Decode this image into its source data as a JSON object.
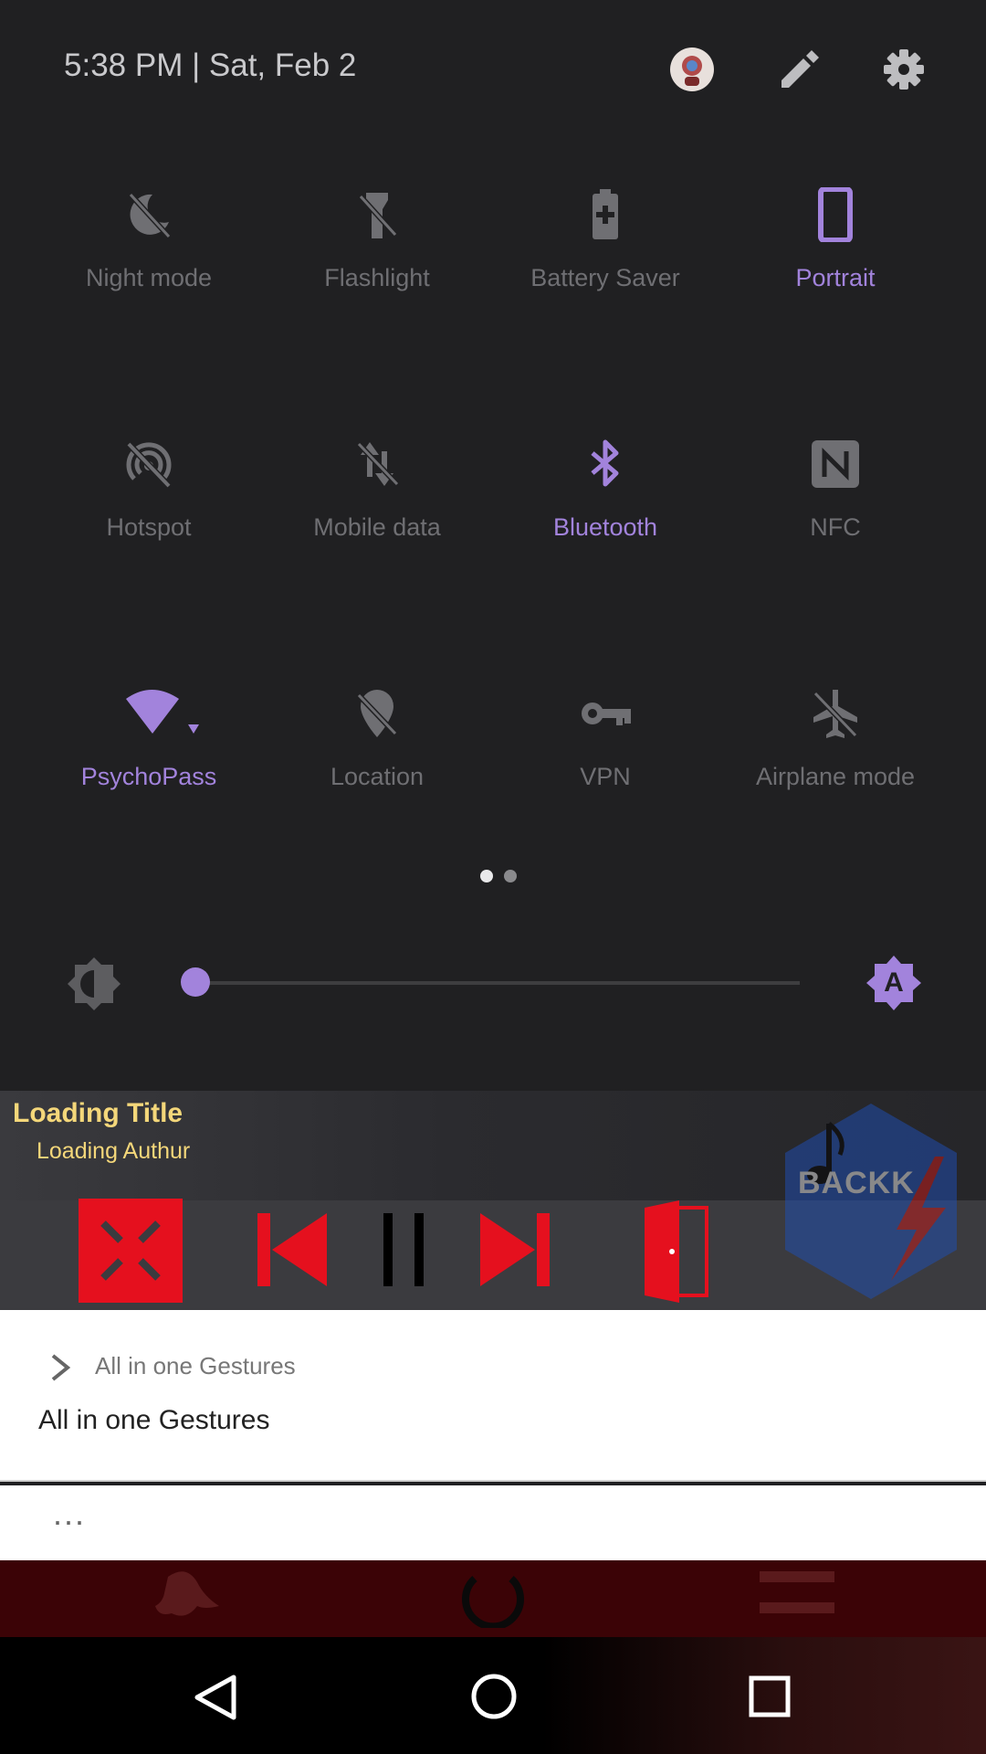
{
  "header": {
    "datetime": "5:38 PM  |  Sat, Feb 2",
    "avatar_icon": "avatar-icon",
    "edit_icon": "pencil-icon",
    "settings_icon": "gear-icon"
  },
  "tiles": [
    {
      "label": "Night mode",
      "icon": "night-mode-off-icon",
      "active": false
    },
    {
      "label": "Flashlight",
      "icon": "flashlight-off-icon",
      "active": false
    },
    {
      "label": "Battery Saver",
      "icon": "battery-plus-icon",
      "active": false
    },
    {
      "label": "Portrait",
      "icon": "portrait-phone-icon",
      "active": true
    },
    {
      "label": "Hotspot",
      "icon": "hotspot-off-icon",
      "active": false
    },
    {
      "label": "Mobile data",
      "icon": "mobile-data-off-icon",
      "active": false
    },
    {
      "label": "Bluetooth",
      "icon": "bluetooth-icon",
      "active": true
    },
    {
      "label": "NFC",
      "icon": "nfc-icon",
      "active": false
    },
    {
      "label": "PsychoPass",
      "icon": "wifi-icon",
      "active": true
    },
    {
      "label": "Location",
      "icon": "location-off-icon",
      "active": false
    },
    {
      "label": "VPN",
      "icon": "key-icon",
      "active": false
    },
    {
      "label": "Airplane mode",
      "icon": "airplane-off-icon",
      "active": false
    }
  ],
  "pager": {
    "pages": 2,
    "current": 1
  },
  "brightness": {
    "value": 0.0,
    "auto_label": "A"
  },
  "media": {
    "title": "Loading Title",
    "author": "Loading Authur",
    "logo_text": "BACKK"
  },
  "notification": {
    "app_name": "All in one Gestures",
    "title": "All in one Gestures",
    "more": "..."
  },
  "colors": {
    "accent": "#a283dc",
    "inactive": "#6f6f73",
    "media_red": "#e5101e",
    "title_yellow": "#f4d77a"
  }
}
